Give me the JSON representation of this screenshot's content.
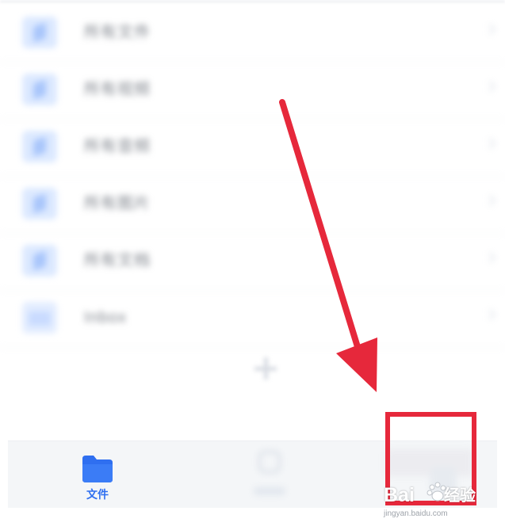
{
  "file_list": {
    "items": [
      {
        "label": "所有文件",
        "icon": "document-icon"
      },
      {
        "label": "所有视频",
        "icon": "document-icon"
      },
      {
        "label": "所有音频",
        "icon": "document-icon"
      },
      {
        "label": "所有图片",
        "icon": "document-icon"
      },
      {
        "label": "所有文档",
        "icon": "document-icon"
      },
      {
        "label": "Inbox",
        "icon": "folder-icon"
      }
    ]
  },
  "bottom_nav": {
    "files_label": "文件",
    "active_color": "#2f6ff0"
  },
  "annotation": {
    "arrow_color": "#e6283b",
    "box_color": "#e6283b"
  },
  "watermark": {
    "brand": "Bai",
    "suffix": "经验",
    "url": "jingyan.baidu.com"
  }
}
